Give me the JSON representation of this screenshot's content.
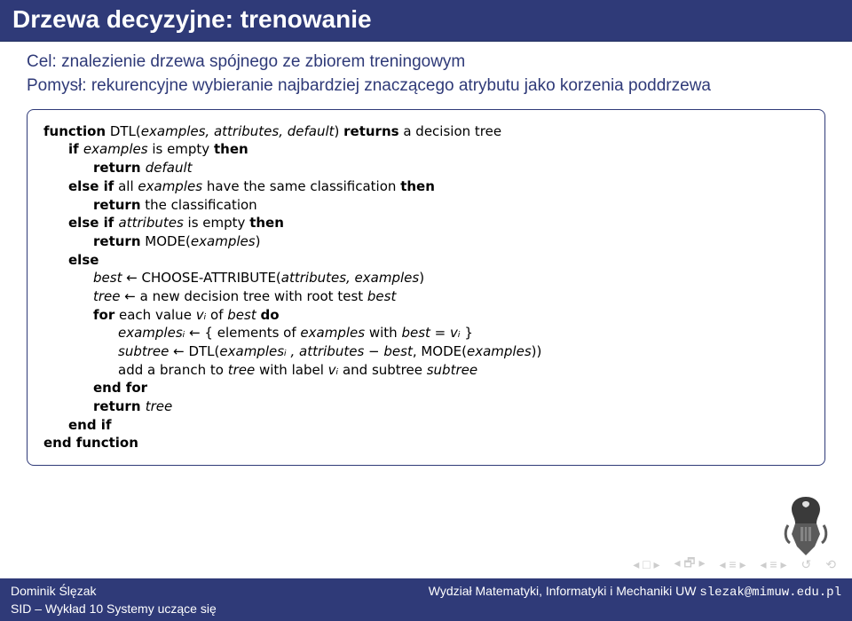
{
  "title": "Drzewa decyzyjne: trenowanie",
  "goal_prefix": "Cel:",
  "goal_text": " znalezienie drzewa spójnego ze zbiorem treningowym",
  "idea_prefix": "Pomysł:",
  "idea_text": " rekurencyjne wybieranie najbardziej znaczącego atrybutu jako korzenia poddrzewa",
  "algo": {
    "l1_kw1": "function",
    "l1_fn": " DTL(",
    "l1_args": "examples, attributes, default",
    "l1_fn2": ") ",
    "l1_kw2": "returns",
    "l1_tail": " a decision tree",
    "l2_kw1": "if ",
    "l2_it": "examples",
    "l2_mid": " is empty ",
    "l2_kw2": "then",
    "l3_kw": "return ",
    "l3_it": "default",
    "l4_kw1": "else if",
    "l4_mid": " all ",
    "l4_it": "examples",
    "l4_mid2": " have the same classification ",
    "l4_kw2": "then",
    "l5_kw": "return",
    "l5_tail": " the classification",
    "l6_kw1": "else if ",
    "l6_it": "attributes",
    "l6_mid": " is empty ",
    "l6_kw2": "then",
    "l7_kw": "return",
    "l7_fn": " MODE(",
    "l7_it": "examples",
    "l7_fn2": ")",
    "l8_kw": "else",
    "l9_it1": "best",
    "l9_arrow": " ← CHOOSE-ATTRIBUTE(",
    "l9_it2": "attributes, examples",
    "l9_fn2": ")",
    "l10_it1": "tree",
    "l10_mid": " ← a new decision tree with root test ",
    "l10_it2": "best",
    "l11_kw1": "for",
    "l11_mid": " each value ",
    "l11_it1": "vᵢ",
    "l11_mid2": " of ",
    "l11_it2": "best ",
    "l11_kw2": "do",
    "l12_it1": "examplesᵢ",
    "l12_mid": " ← { elements of ",
    "l12_it2": "examples",
    "l12_mid2": " with ",
    "l12_it3": "best",
    "l12_eq": " = ",
    "l12_it4": "vᵢ",
    "l12_brace": " }",
    "l13_it1": "subtree",
    "l13_arrow": " ← DTL(",
    "l13_it2": "examplesᵢ , attributes",
    "l13_minus": " − ",
    "l13_it3": "best",
    "l13_comma": ", MODE(",
    "l13_it4": "examples",
    "l13_fn2": "))",
    "l14_txt": "add a branch to ",
    "l14_it1": "tree",
    "l14_mid": " with label ",
    "l14_it2": "vᵢ",
    "l14_mid2": " and subtree ",
    "l14_it3": "subtree",
    "l15_kw": "end for",
    "l16_kw": "return ",
    "l16_it": "tree",
    "l17_kw": "end if",
    "l18_kw": "end function"
  },
  "footer": {
    "author": "Dominik Ślęzak",
    "affil": "Wydział Matematyki, Informatyki i Mechaniki UW ",
    "email": "slezak@mimuw.edu.pl",
    "course": "SID – Wykład 10 Systemy uczące się"
  },
  "nav": {
    "first": "◂ □ ▸",
    "prev": "◂ 🗗 ▸",
    "sec": "◂ ≡ ▸",
    "sub": "◂ ≡ ▸",
    "back": "↺",
    "quit": "⟲"
  },
  "colors": {
    "brand": "#2f3a78"
  }
}
